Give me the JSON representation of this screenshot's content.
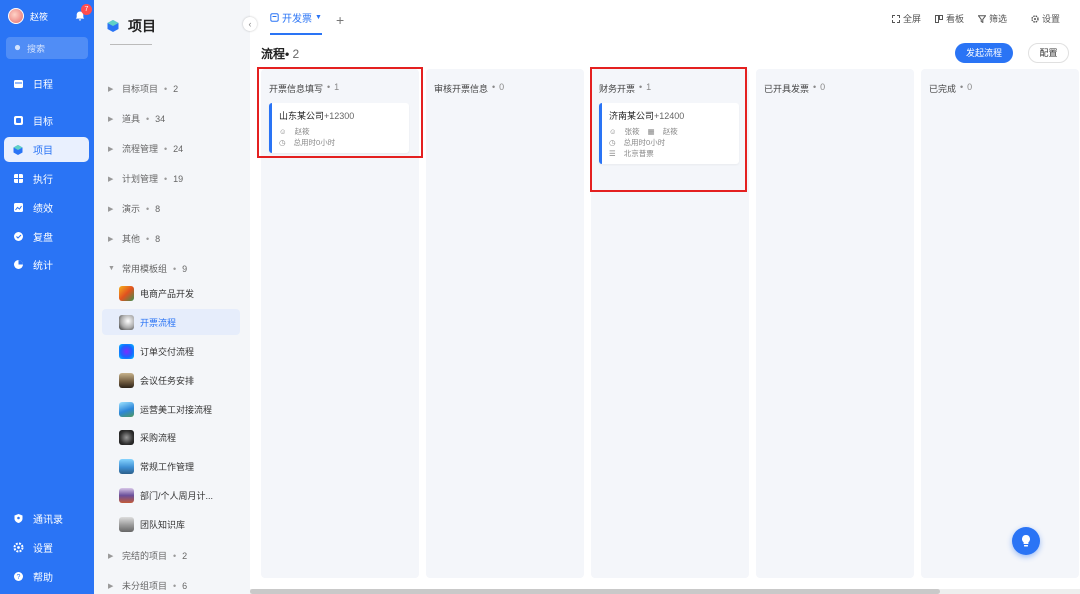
{
  "nav": {
    "user_name": "赵筱",
    "notification_count": "7",
    "search_placeholder": "搜索",
    "items_top": [
      {
        "label": "日程",
        "icon": "calendar-icon"
      },
      {
        "label": "目标",
        "icon": "target-icon"
      },
      {
        "label": "项目",
        "icon": "cube-icon",
        "active": true
      },
      {
        "label": "执行",
        "icon": "grid-icon"
      },
      {
        "label": "绩效",
        "icon": "chart-icon"
      },
      {
        "label": "复盘",
        "icon": "review-icon"
      },
      {
        "label": "统计",
        "icon": "pie-icon"
      }
    ],
    "items_bottom": [
      {
        "label": "通讯录",
        "icon": "contacts-icon"
      },
      {
        "label": "设置",
        "icon": "gear-icon"
      },
      {
        "label": "帮助",
        "icon": "help-icon"
      }
    ]
  },
  "project_panel": {
    "title": "项目",
    "groups_top": [
      {
        "label": "目标项目",
        "count": "2"
      },
      {
        "label": "道具",
        "count": "34"
      },
      {
        "label": "流程管理",
        "count": "24"
      },
      {
        "label": "计划管理",
        "count": "19"
      },
      {
        "label": "演示",
        "count": "8"
      },
      {
        "label": "其他",
        "count": "8"
      },
      {
        "label": "常用模板组",
        "count": "9"
      }
    ],
    "templates": [
      {
        "label": "电商产品开发"
      },
      {
        "label": "开票流程",
        "active": true
      },
      {
        "label": "订单交付流程"
      },
      {
        "label": "会议任务安排"
      },
      {
        "label": "运营美工对接流程"
      },
      {
        "label": "采购流程"
      },
      {
        "label": "常规工作管理"
      },
      {
        "label": "部门/个人周月计..."
      },
      {
        "label": "团队知识库"
      }
    ],
    "groups_bottom": [
      {
        "label": "完结的项目",
        "count": "2"
      },
      {
        "label": "未分组项目",
        "count": "6"
      }
    ]
  },
  "main": {
    "tab_label": "开发票",
    "toolbar": {
      "fullscreen": "全屏",
      "board": "看板",
      "filter": "筛选",
      "settings": "设置"
    },
    "header_title": "流程•",
    "header_count": "2",
    "primary_button": "发起流程",
    "config_button": "配置",
    "columns": [
      {
        "title": "开票信息填写",
        "count": "1",
        "cards": [
          {
            "company": "山东某公司",
            "amount": "+12300",
            "person": "赵筱",
            "time": "总用时0小时"
          }
        ]
      },
      {
        "title": "审核开票信息",
        "count": "0",
        "cards": []
      },
      {
        "title": "财务开票",
        "count": "1",
        "cards": [
          {
            "company": "济南某公司",
            "amount": "+12400",
            "person": "张筱",
            "person2": "赵筱",
            "time": "总用时0小时",
            "extra": "北京普票"
          }
        ]
      },
      {
        "title": "已开具发票",
        "count": "0",
        "cards": []
      },
      {
        "title": "已完成",
        "count": "0",
        "cards": []
      }
    ]
  },
  "colors": {
    "accent": "#2a74f5",
    "highlight": "#e42020"
  }
}
